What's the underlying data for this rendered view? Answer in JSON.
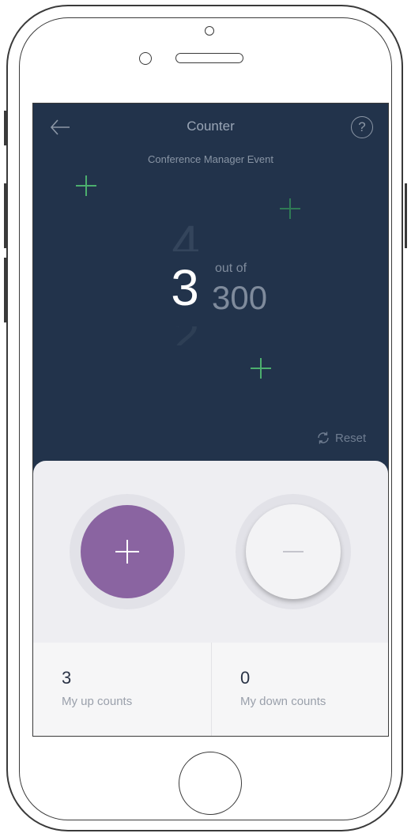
{
  "header": {
    "title": "Counter",
    "subtitle": "Conference Manager Event",
    "help_symbol": "?",
    "back_icon": "arrow-left-icon",
    "help_icon": "question-circle-icon"
  },
  "counter": {
    "current": "3",
    "next_ghost": "4",
    "prev_ghost": "2",
    "out_of_label": "out of",
    "total": "300"
  },
  "reset": {
    "label": "Reset",
    "icon": "refresh-icon"
  },
  "controls": {
    "increment_icon": "plus-icon",
    "decrement_icon": "minus-icon"
  },
  "stats": {
    "up": {
      "value": "3",
      "label": "My up counts"
    },
    "down": {
      "value": "0",
      "label": "My down counts"
    }
  },
  "colors": {
    "header_bg": "#22334b",
    "accent_purple": "#8a64a1",
    "plus_green": "#4caf6e"
  }
}
